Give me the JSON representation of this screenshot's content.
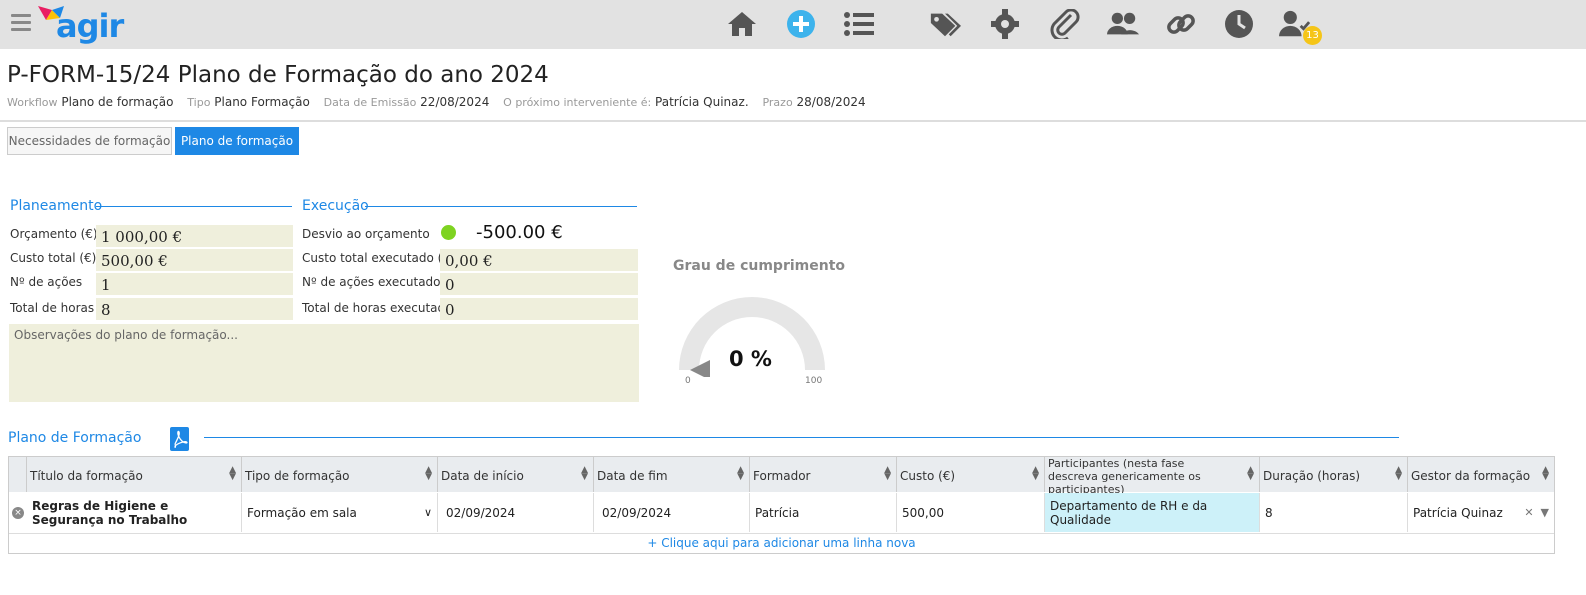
{
  "app": {
    "logo_text": "agir",
    "badge_count": "13"
  },
  "nav_icons": [
    "home-icon",
    "add-icon",
    "list-icon",
    "tags-icon",
    "gear-icon",
    "paperclip-icon",
    "users-icon",
    "link-icon",
    "clock-icon",
    "user-check-icon"
  ],
  "header": {
    "title": "P-FORM-15/24 Plano de Formação do ano 2024",
    "meta": {
      "workflow_k": "Workflow",
      "workflow_v": "Plano de formação",
      "tipo_k": "Tipo",
      "tipo_v": "Plano Formação",
      "data_k": "Data de Emissão",
      "data_v": "22/08/2024",
      "prox_k": "O próximo interveniente é:",
      "prox_v": "Patrícia Quinaz.",
      "prazo_k": "Prazo",
      "prazo_v": "28/08/2024"
    }
  },
  "tabs": [
    {
      "label": "Necessidades de formação"
    },
    {
      "label": "Plano de formação"
    }
  ],
  "planeamento": {
    "title": "Planeamento",
    "orcamento_l": "Orçamento (€)",
    "orcamento_v": "1 000,00 €",
    "custo_l": "Custo total (€)",
    "custo_v": "500,00 €",
    "acoes_l": "Nº de ações",
    "acoes_v": "1",
    "horas_l": "Total de horas",
    "horas_v": "8",
    "notes_placeholder": "Observações do plano de formação..."
  },
  "execucao": {
    "title": "Execução",
    "desvio_l": "Desvio ao orçamento",
    "desvio_v": "-500.00 €",
    "custo_l": "Custo total executado (€)",
    "custo_v": "0,00 €",
    "acoes_l": "Nº de ações executado",
    "acoes_v": "0",
    "horas_l": "Total de horas executadas",
    "horas_v": "0",
    "status_color": "#7ed321"
  },
  "gauge": {
    "title": "Grau de cumprimento",
    "value_label": "0 %",
    "value": 0,
    "min": "0",
    "max": "100"
  },
  "plano": {
    "title": "Plano de Formação",
    "columns": [
      "Título da formação",
      "Tipo de formação",
      "Data de início",
      "Data de fim",
      "Formador",
      "Custo (€)",
      "Participantes (nesta fase descreva genericamente os participantes)",
      "Duração (horas)",
      "Gestor da formação"
    ],
    "row": {
      "titulo": "Regras de Higiene e Segurança no Trabalho",
      "tipo": "Formação em sala",
      "inicio": "02/09/2024",
      "fim": "02/09/2024",
      "formador": "Patrícia",
      "custo": "500,00",
      "participantes": "Departamento de RH e da Qualidade",
      "duracao": "8",
      "gestor": "Patrícia Quinaz"
    },
    "add_row": "+ Clique aqui para adicionar uma linha nova"
  },
  "colors": {
    "accent": "#1e88e5",
    "field_bg": "#efefdc",
    "highlight": "#cdf1f9"
  }
}
